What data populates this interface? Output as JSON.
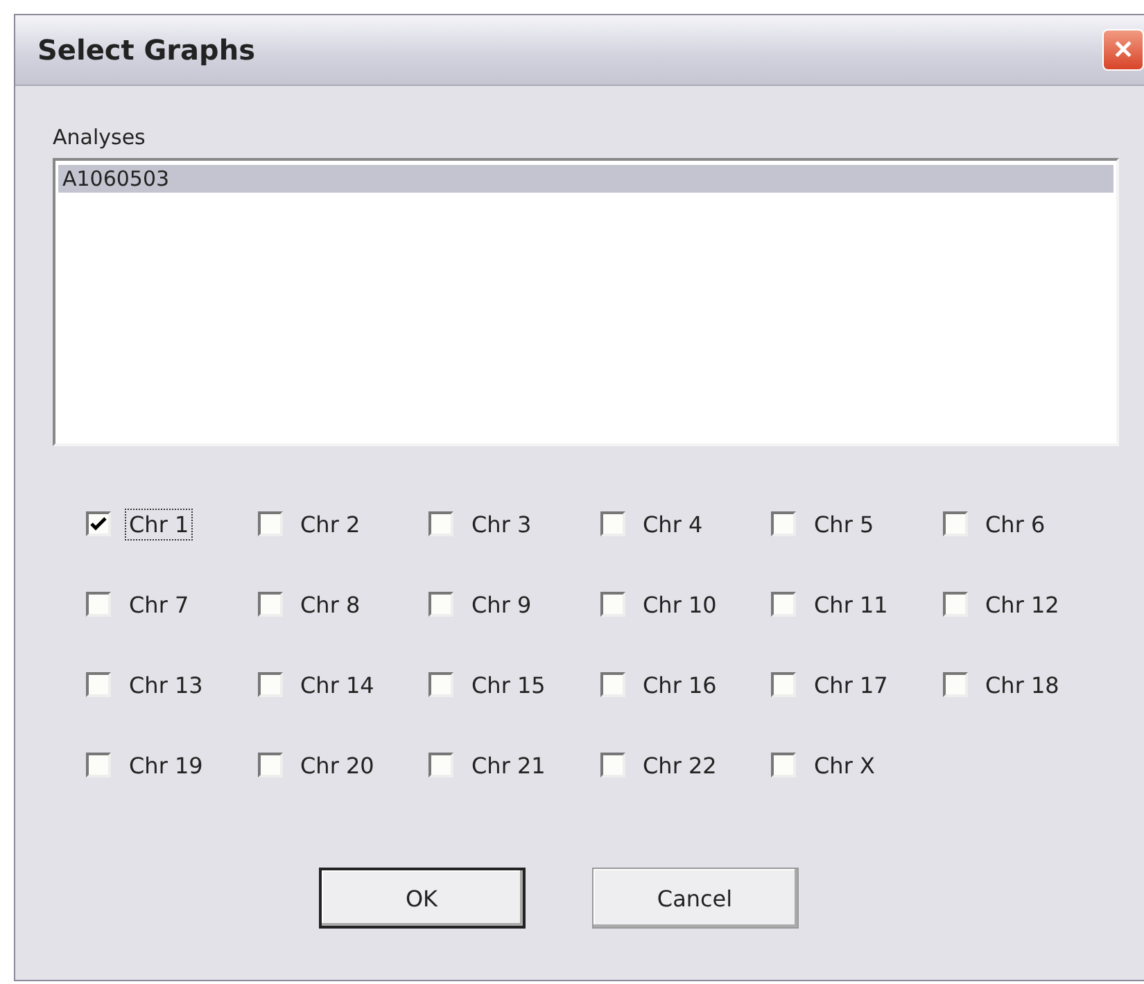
{
  "window": {
    "title": "Select Graphs",
    "close_label": "✕"
  },
  "analyses": {
    "label": "Analyses",
    "items": [
      {
        "label": "A1060503",
        "selected": true
      }
    ]
  },
  "chromosomes": [
    {
      "label": "Chr 1",
      "checked": true,
      "focused": true
    },
    {
      "label": "Chr 2",
      "checked": false,
      "focused": false
    },
    {
      "label": "Chr 3",
      "checked": false,
      "focused": false
    },
    {
      "label": "Chr 4",
      "checked": false,
      "focused": false
    },
    {
      "label": "Chr 5",
      "checked": false,
      "focused": false
    },
    {
      "label": "Chr 6",
      "checked": false,
      "focused": false
    },
    {
      "label": "Chr 7",
      "checked": false,
      "focused": false
    },
    {
      "label": "Chr 8",
      "checked": false,
      "focused": false
    },
    {
      "label": "Chr 9",
      "checked": false,
      "focused": false
    },
    {
      "label": "Chr 10",
      "checked": false,
      "focused": false
    },
    {
      "label": "Chr 11",
      "checked": false,
      "focused": false
    },
    {
      "label": "Chr 12",
      "checked": false,
      "focused": false
    },
    {
      "label": "Chr 13",
      "checked": false,
      "focused": false
    },
    {
      "label": "Chr 14",
      "checked": false,
      "focused": false
    },
    {
      "label": "Chr 15",
      "checked": false,
      "focused": false
    },
    {
      "label": "Chr 16",
      "checked": false,
      "focused": false
    },
    {
      "label": "Chr 17",
      "checked": false,
      "focused": false
    },
    {
      "label": "Chr 18",
      "checked": false,
      "focused": false
    },
    {
      "label": "Chr 19",
      "checked": false,
      "focused": false
    },
    {
      "label": "Chr 20",
      "checked": false,
      "focused": false
    },
    {
      "label": "Chr 21",
      "checked": false,
      "focused": false
    },
    {
      "label": "Chr 22",
      "checked": false,
      "focused": false
    },
    {
      "label": "Chr X",
      "checked": false,
      "focused": false
    }
  ],
  "buttons": [
    {
      "label": "OK",
      "default": true
    },
    {
      "label": "Cancel",
      "default": false
    }
  ]
}
